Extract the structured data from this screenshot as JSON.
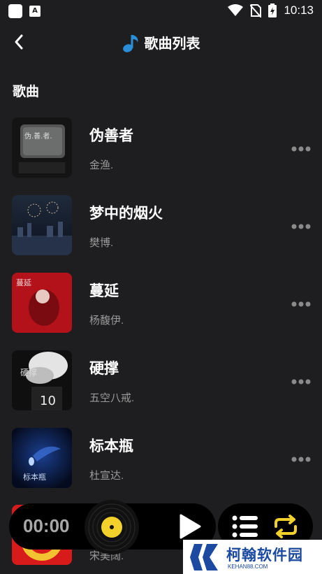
{
  "status_bar": {
    "time": "10:13",
    "icons": [
      "app-icon",
      "a-icon",
      "wifi-icon",
      "no-sim-icon",
      "battery-charging-icon"
    ]
  },
  "header": {
    "title": "歌曲列表",
    "back_icon": "back-arrow-icon",
    "title_icon": "music-note-icon"
  },
  "section_title": "歌曲",
  "songs": [
    {
      "title": "伪善者",
      "artist": "金渔."
    },
    {
      "title": "梦中的烟火",
      "artist": "樊博."
    },
    {
      "title": "蔓延",
      "artist": "杨馥伊."
    },
    {
      "title": "硬撑",
      "artist": "五空八戒."
    },
    {
      "title": "标本瓶",
      "artist": "杜宣达."
    }
  ],
  "partial_song": {
    "artist": "宋美阔."
  },
  "cover_text": {
    "song1": "伪.善.者.",
    "song3": "蔓延",
    "song4": "硬撑",
    "song5": "标本瓶"
  },
  "player": {
    "time": "00:00"
  },
  "colors": {
    "background": "#1e1e20",
    "vinyl_label": "#f2d12a",
    "repeat": "#f2d12a",
    "secondary_text": "#9a9a9a"
  },
  "watermark": {
    "title": "柯翰软件园",
    "subtitle": "KEHAN88.COM"
  }
}
